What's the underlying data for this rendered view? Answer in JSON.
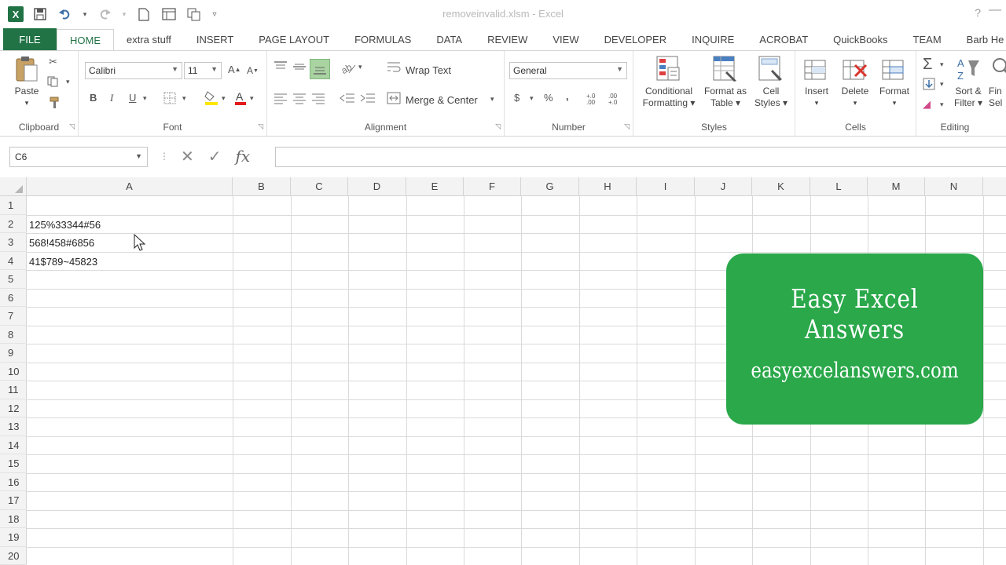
{
  "window": {
    "title": "removeinvalid.xlsm - Excel",
    "help": "?",
    "minimize": "—"
  },
  "qat": {
    "logo": "X",
    "icons": [
      "save-icon",
      "undo-icon",
      "redo-icon",
      "new-icon",
      "print-preview-icon",
      "copy-icon",
      "customize-qat-icon"
    ]
  },
  "tabs": [
    "FILE",
    "HOME",
    "extra stuff",
    "INSERT",
    "PAGE LAYOUT",
    "FORMULAS",
    "DATA",
    "REVIEW",
    "VIEW",
    "DEVELOPER",
    "INQUIRE",
    "ACROBAT",
    "QuickBooks",
    "TEAM",
    "Barb He"
  ],
  "ribbon": {
    "clipboard": {
      "label": "Clipboard",
      "paste": "Paste"
    },
    "font": {
      "label": "Font",
      "name": "Calibri",
      "size": "11",
      "bold": "B",
      "italic": "I",
      "underline": "U"
    },
    "alignment": {
      "label": "Alignment",
      "wrap": "Wrap Text",
      "merge": "Merge & Center"
    },
    "number": {
      "label": "Number",
      "format": "General",
      "currency": "$",
      "percent": "%",
      "comma": ",",
      "inc_dec": "+.0 .00",
      "dec_dec": ".00 +.0"
    },
    "styles": {
      "label": "Styles",
      "conditional_1": "Conditional",
      "conditional_2": "Formatting ▾",
      "table_1": "Format as",
      "table_2": "Table ▾",
      "cell_1": "Cell",
      "cell_2": "Styles ▾"
    },
    "cells": {
      "label": "Cells",
      "insert": "Insert",
      "delete": "Delete",
      "format": "Format"
    },
    "editing": {
      "label": "Editing",
      "sort_1": "Sort &",
      "sort_2": "Filter ▾",
      "find_1": "Fin",
      "find_2": "Sel"
    }
  },
  "formula_bar": {
    "name_box": "C6",
    "separator": "⋮",
    "cancel": "✕",
    "enter": "✓",
    "fx": "fx",
    "value": ""
  },
  "columns": [
    "A",
    "B",
    "C",
    "D",
    "E",
    "F",
    "G",
    "H",
    "I",
    "J",
    "K",
    "L",
    "M",
    "N"
  ],
  "rows": [
    "1",
    "2",
    "3",
    "4",
    "5",
    "6",
    "7",
    "8",
    "9",
    "10",
    "11",
    "12",
    "13",
    "14",
    "15",
    "16",
    "17",
    "18",
    "19",
    "20"
  ],
  "cells": {
    "A2": "125%33344#56",
    "A3": "568!458#6856",
    "A4": "41$789~45823"
  },
  "brand": {
    "title": "Easy Excel Answers",
    "url": "easyexcelanswers.com",
    "color": "#2aa84a"
  },
  "colors": {
    "excel_green": "#217346"
  }
}
